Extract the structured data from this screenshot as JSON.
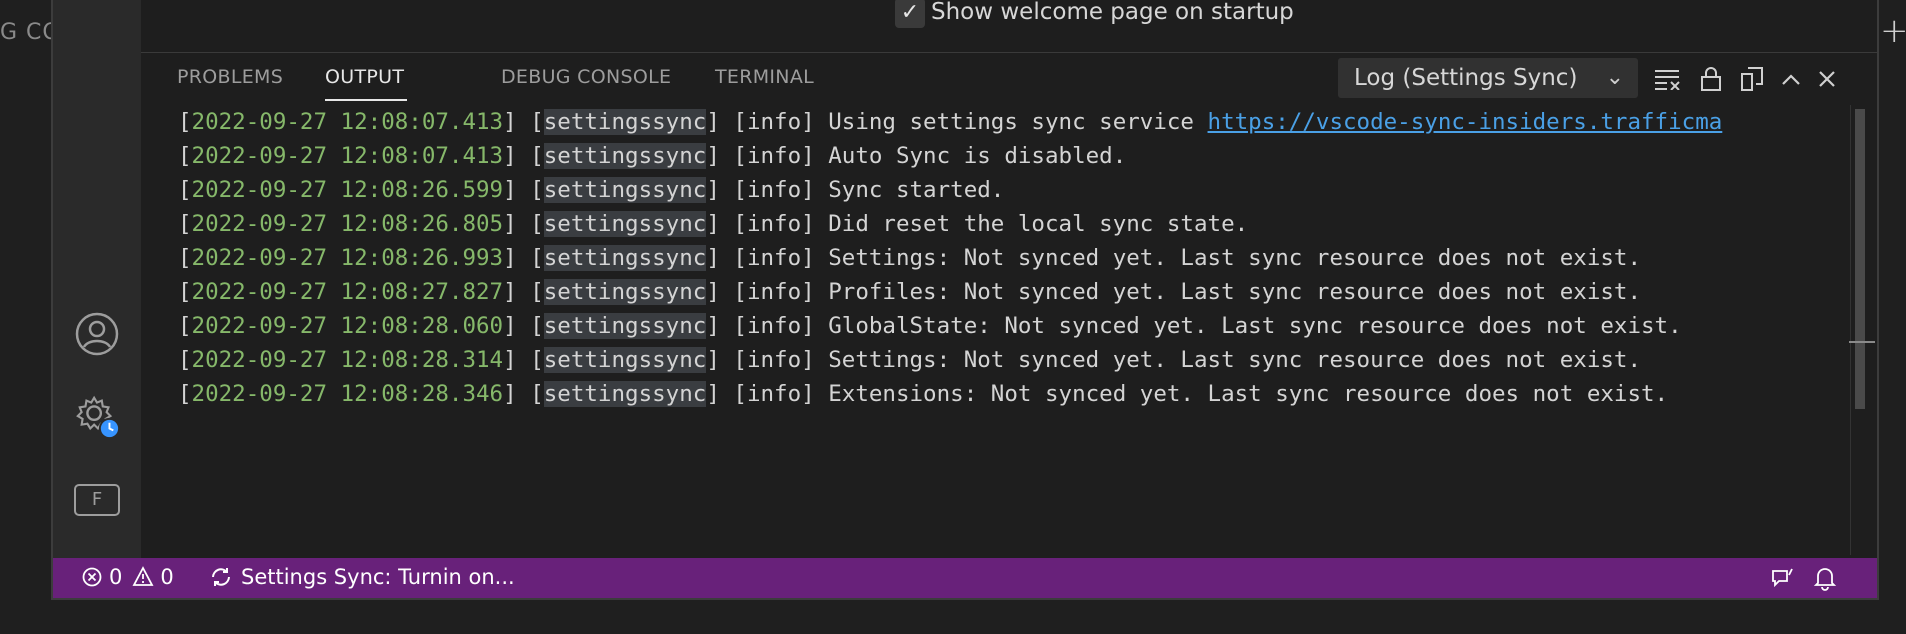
{
  "background_fragment": {
    "left_label": "G CO",
    "plus_glyph": "+"
  },
  "welcome": {
    "checkbox_checked": true,
    "label": "Show welcome page on startup"
  },
  "panel": {
    "tabs": [
      {
        "label": "PROBLEMS",
        "active": false
      },
      {
        "label": "OUTPUT",
        "active": true
      },
      {
        "label": "DEBUG CONSOLE",
        "active": false
      },
      {
        "label": "TERMINAL",
        "active": false
      }
    ],
    "channel_select": {
      "value": "Log (Settings Sync)"
    },
    "toolbar_icons": [
      "clear-output-icon",
      "lock-scroll-icon",
      "open-editor-icon",
      "maximize-panel-icon",
      "close-panel-icon"
    ]
  },
  "log": [
    {
      "ts": "2022-09-27 12:08:07.413",
      "src": "settingssync",
      "level": "info",
      "msg": "Using settings sync service ",
      "url": "https://vscode-sync-insiders.trafficma"
    },
    {
      "ts": "2022-09-27 12:08:07.413",
      "src": "settingssync",
      "level": "info",
      "msg": "Auto Sync is disabled."
    },
    {
      "ts": "2022-09-27 12:08:26.599",
      "src": "settingssync",
      "level": "info",
      "msg": "Sync started."
    },
    {
      "ts": "2022-09-27 12:08:26.805",
      "src": "settingssync",
      "level": "info",
      "msg": "Did reset the local sync state."
    },
    {
      "ts": "2022-09-27 12:08:26.993",
      "src": "settingssync",
      "level": "info",
      "msg": "Settings: Not synced yet. Last sync resource does not exist."
    },
    {
      "ts": "2022-09-27 12:08:27.827",
      "src": "settingssync",
      "level": "info",
      "msg": "Profiles: Not synced yet. Last sync resource does not exist."
    },
    {
      "ts": "2022-09-27 12:08:28.060",
      "src": "settingssync",
      "level": "info",
      "msg": "GlobalState: Not synced yet. Last sync resource does not exist."
    },
    {
      "ts": "2022-09-27 12:08:28.314",
      "src": "settingssync",
      "level": "info",
      "msg": "Settings: Not synced yet. Last sync resource does not exist."
    },
    {
      "ts": "2022-09-27 12:08:28.346",
      "src": "settingssync",
      "level": "info",
      "msg": "Extensions: Not synced yet. Last sync resource does not exist."
    }
  ],
  "activity_bar": {
    "icons": [
      "accounts-icon",
      "manage-gear-icon",
      "profile-badge-icon"
    ],
    "profile_badge": "F"
  },
  "status_bar": {
    "errors": "0",
    "warnings": "0",
    "sync_text": "Settings Sync: Turnin on...",
    "color": "#68217a"
  }
}
